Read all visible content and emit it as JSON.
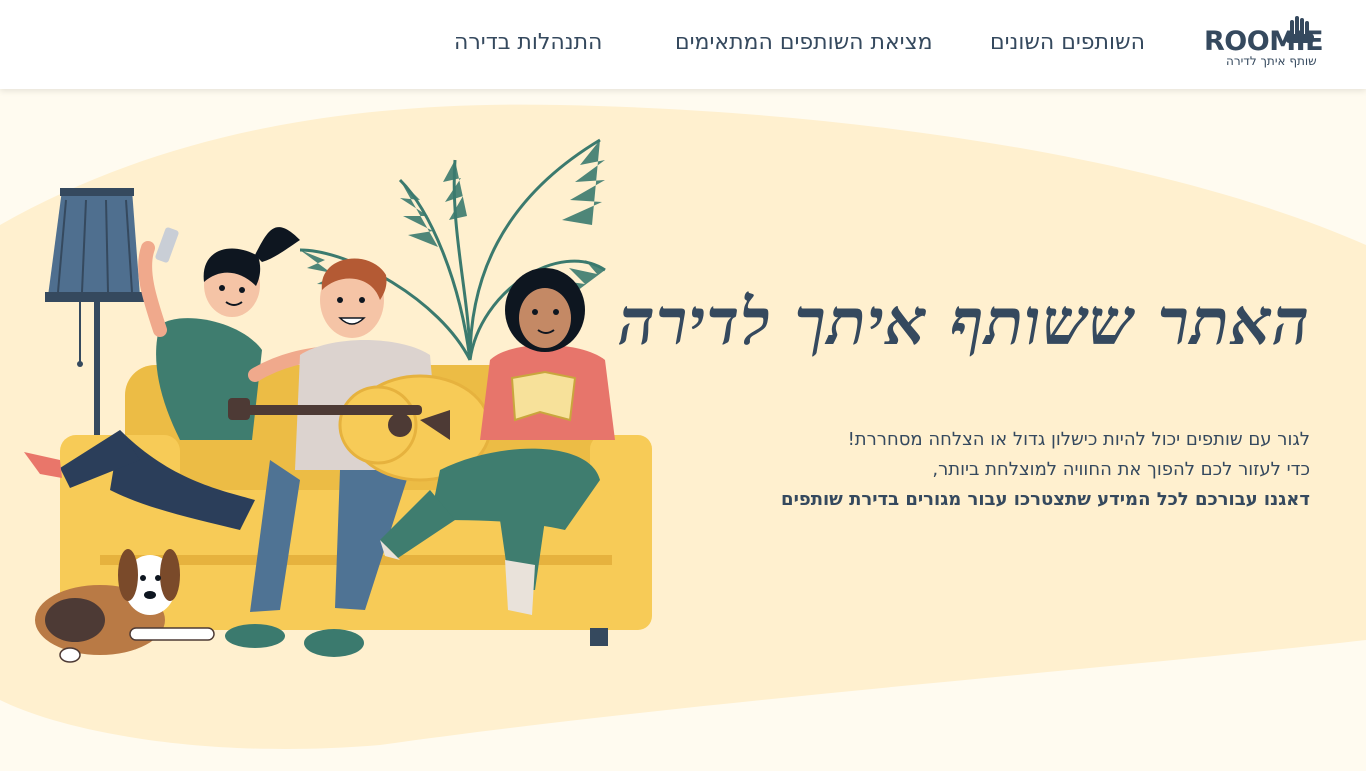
{
  "header": {
    "logo_text": "ROOMIE",
    "logo_tagline": "שותף איתך לדירה",
    "nav": [
      {
        "label": "השותפים השונים"
      },
      {
        "label": "מציאת השותפים המתאימים"
      },
      {
        "label": "התנהלות בדירה"
      }
    ]
  },
  "hero": {
    "title": "האתר ששותף איתך לדירה",
    "line1": "לגור עם שותפים יכול להיות כישלון גדול או הצלחה מסחררת!",
    "line2": "כדי לעזור לכם להפוך את החוויה למוצלחת ביותר,",
    "line3": "דאגנו עבורכם לכל המידע שתצטרכו עבור מגורים בדירת שותפים"
  },
  "colors": {
    "primary": "#35495e",
    "blob": "#fff0cf",
    "sofa": "#f7cb57",
    "page_bg": "#fffbf0"
  }
}
